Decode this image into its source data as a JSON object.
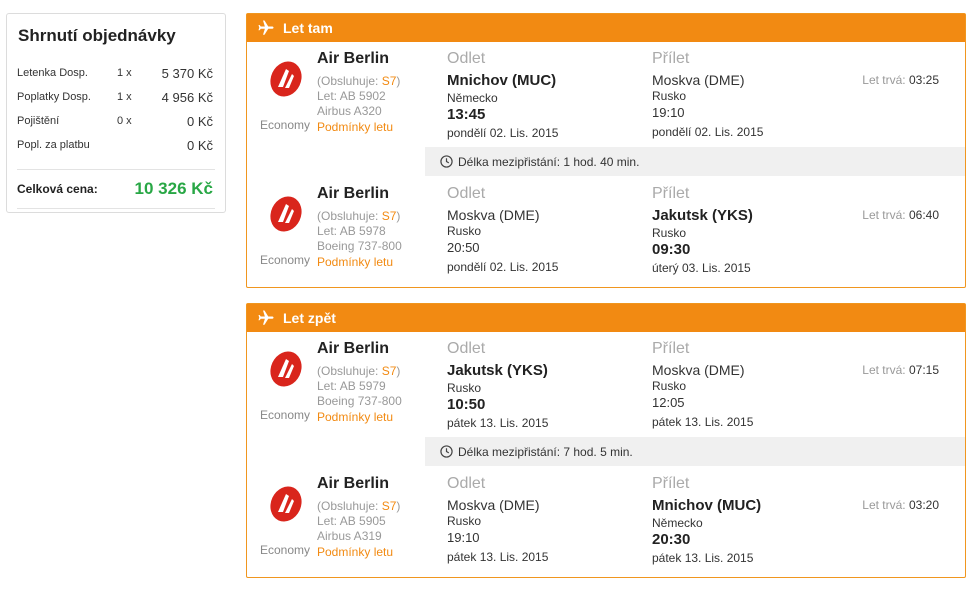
{
  "summary": {
    "title": "Shrnutí objednávky",
    "rows": [
      {
        "label": "Letenka Dosp.",
        "qty": "1 x",
        "amount": "5 370 Kč"
      },
      {
        "label": "Poplatky Dosp.",
        "qty": "1 x",
        "amount": "4 956 Kč"
      },
      {
        "label": "Pojištění",
        "qty": "0 x",
        "amount": "0 Kč"
      },
      {
        "label": "Popl. za platbu",
        "qty": "",
        "amount": "0 Kč"
      }
    ],
    "total_label": "Celková cena:",
    "total_amount": "10 326 Kč",
    "total_color": "#28a745"
  },
  "colors": {
    "accent": "#f28a12",
    "layover_bg": "#f0f0f0"
  },
  "outbound": {
    "title": "Let tam",
    "icon": "airplane-icon",
    "segments": [
      {
        "airline": "Air Berlin",
        "operated_prefix": "(Obsluhuje: ",
        "operated_code": "S7",
        "operated_suffix": ")",
        "flight_no": "Let: AB 5902",
        "aircraft": "Airbus A320",
        "conditions": "Podmínky letu",
        "class": "Economy",
        "dep_head": "Odlet",
        "dep_city": "Mnichov (MUC)",
        "dep_country": "Německo",
        "dep_time": "13:45",
        "dep_date": "pondělí 02. Lis. 2015",
        "arr_head": "Přílet",
        "arr_city": "Moskva (DME)",
        "arr_country": "Rusko",
        "arr_time": "19:10",
        "arr_date": "pondělí 02. Lis. 2015",
        "duration_label": "Let trvá:",
        "duration": "03:25"
      },
      {
        "airline": "Air Berlin",
        "operated_prefix": "(Obsluhuje: ",
        "operated_code": "S7",
        "operated_suffix": ")",
        "flight_no": "Let: AB 5978",
        "aircraft": "Boeing 737-800",
        "conditions": "Podmínky letu",
        "class": "Economy",
        "dep_head": "Odlet",
        "dep_city": "Moskva (DME)",
        "dep_country": "Rusko",
        "dep_time": "20:50",
        "dep_date": "pondělí 02. Lis. 2015",
        "arr_head": "Přílet",
        "arr_city": "Jakutsk (YKS)",
        "arr_country": "Rusko",
        "arr_time": "09:30",
        "arr_date": "úterý 03. Lis. 2015",
        "duration_label": "Let trvá:",
        "duration": "06:40"
      }
    ],
    "layover": "Délka mezipřistání: 1 hod. 40 min."
  },
  "return": {
    "title": "Let zpět",
    "icon": "airplane-icon",
    "segments": [
      {
        "airline": "Air Berlin",
        "operated_prefix": "(Obsluhuje: ",
        "operated_code": "S7",
        "operated_suffix": ")",
        "flight_no": "Let: AB 5979",
        "aircraft": "Boeing 737-800",
        "conditions": "Podmínky letu",
        "class": "Economy",
        "dep_head": "Odlet",
        "dep_city": "Jakutsk (YKS)",
        "dep_country": "Rusko",
        "dep_time": "10:50",
        "dep_date": "pátek 13. Lis. 2015",
        "arr_head": "Přílet",
        "arr_city": "Moskva (DME)",
        "arr_country": "Rusko",
        "arr_time": "12:05",
        "arr_date": "pátek 13. Lis. 2015",
        "duration_label": "Let trvá:",
        "duration": "07:15"
      },
      {
        "airline": "Air Berlin",
        "operated_prefix": "(Obsluhuje: ",
        "operated_code": "S7",
        "operated_suffix": ")",
        "flight_no": "Let: AB 5905",
        "aircraft": "Airbus A319",
        "conditions": "Podmínky letu",
        "class": "Economy",
        "dep_head": "Odlet",
        "dep_city": "Moskva (DME)",
        "dep_country": "Rusko",
        "dep_time": "19:10",
        "dep_date": "pátek 13. Lis. 2015",
        "arr_head": "Přílet",
        "arr_city": "Mnichov (MUC)",
        "arr_country": "Německo",
        "arr_time": "20:30",
        "arr_date": "pátek 13. Lis. 2015",
        "duration_label": "Let trvá:",
        "duration": "03:20"
      }
    ],
    "layover": "Délka mezipřistání: 7 hod. 5 min."
  }
}
